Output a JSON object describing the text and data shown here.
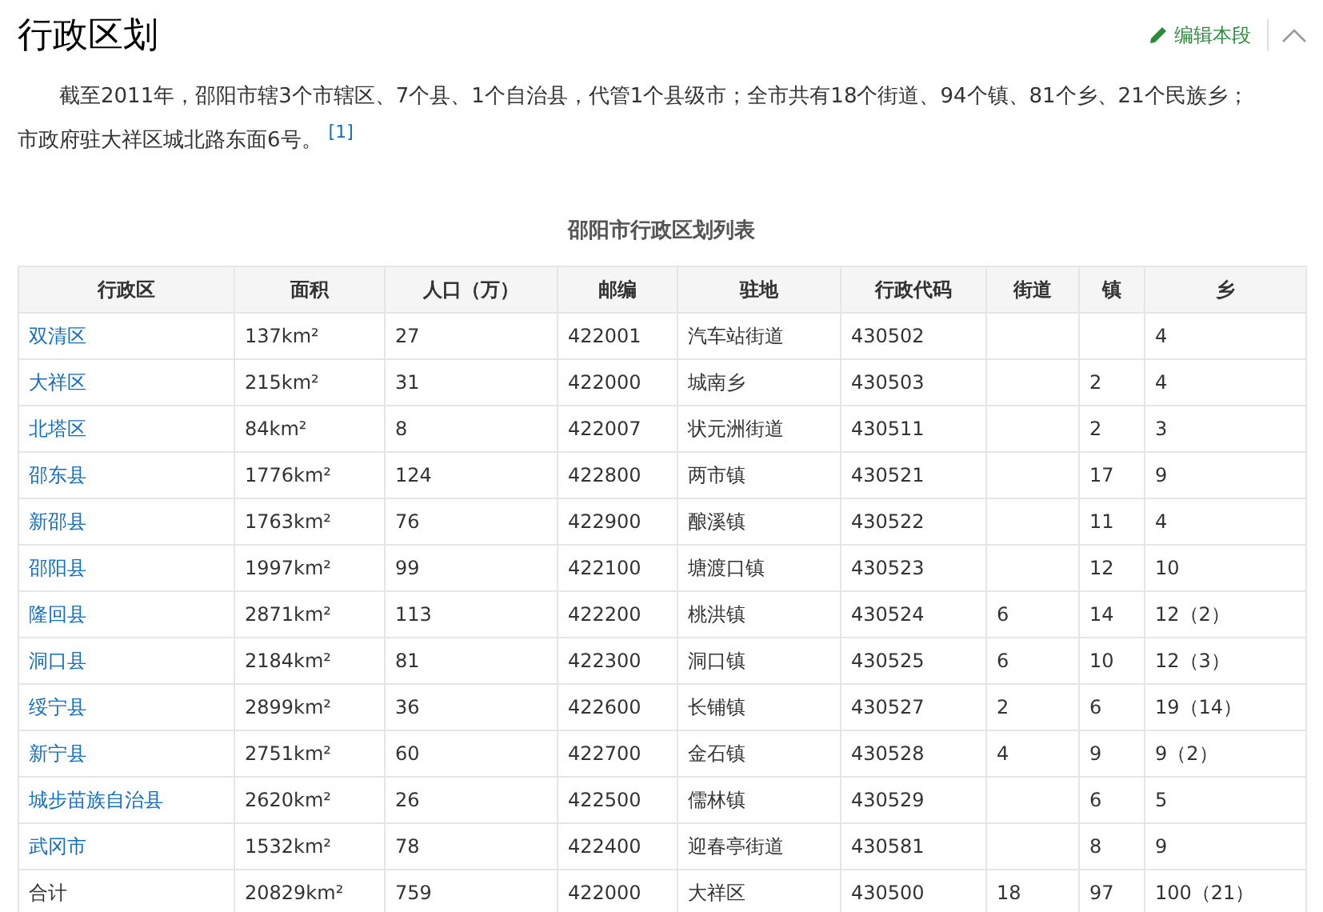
{
  "section": {
    "title": "行政区划",
    "edit_label": "编辑本段"
  },
  "paragraph": {
    "text": "截至2011年，邵阳市辖3个市辖区、7个县、1个自治县，代管1个县级市；全市共有18个街道、94个镇、81个乡、21个民族乡；市政府驻大祥区城北路东面6号。",
    "reference": "[1]"
  },
  "table": {
    "caption": "邵阳市行政区划列表",
    "columns": [
      "行政区",
      "面积",
      "人口（万）",
      "邮编",
      "驻地",
      "行政代码",
      "街道",
      "镇",
      "乡"
    ],
    "rows": [
      {
        "linked": true,
        "cells": [
          "双清区",
          "137km²",
          "27",
          "422001",
          "汽车站街道",
          "430502",
          "",
          "",
          "4"
        ]
      },
      {
        "linked": true,
        "cells": [
          "大祥区",
          "215km²",
          "31",
          "422000",
          "城南乡",
          "430503",
          "",
          "2",
          "4"
        ]
      },
      {
        "linked": true,
        "cells": [
          "北塔区",
          "84km²",
          "8",
          "422007",
          "状元洲街道",
          "430511",
          "",
          "2",
          "3"
        ]
      },
      {
        "linked": true,
        "cells": [
          "邵东县",
          "1776km²",
          "124",
          "422800",
          "两市镇",
          "430521",
          "",
          "17",
          "9"
        ]
      },
      {
        "linked": true,
        "cells": [
          "新邵县",
          "1763km²",
          "76",
          "422900",
          "酿溪镇",
          "430522",
          "",
          "11",
          "4"
        ]
      },
      {
        "linked": true,
        "cells": [
          "邵阳县",
          "1997km²",
          "99",
          "422100",
          "塘渡口镇",
          "430523",
          "",
          "12",
          "10"
        ]
      },
      {
        "linked": true,
        "cells": [
          "隆回县",
          "2871km²",
          "113",
          "422200",
          "桃洪镇",
          "430524",
          "6",
          "14",
          "12（2）"
        ]
      },
      {
        "linked": true,
        "cells": [
          "洞口县",
          "2184km²",
          "81",
          "422300",
          "洞口镇",
          "430525",
          "6",
          "10",
          "12（3）"
        ]
      },
      {
        "linked": true,
        "cells": [
          "绥宁县",
          "2899km²",
          "36",
          "422600",
          "长铺镇",
          "430527",
          "2",
          "6",
          "19（14）"
        ]
      },
      {
        "linked": true,
        "cells": [
          "新宁县",
          "2751km²",
          "60",
          "422700",
          "金石镇",
          "430528",
          "4",
          "9",
          "9（2）"
        ]
      },
      {
        "linked": true,
        "cells": [
          "城步苗族自治县",
          "2620km²",
          "26",
          "422500",
          "儒林镇",
          "430529",
          "",
          "6",
          "5"
        ]
      },
      {
        "linked": true,
        "cells": [
          "武冈市",
          "1532km²",
          "78",
          "422400",
          "迎春亭街道",
          "430581",
          "",
          "8",
          "9"
        ]
      },
      {
        "linked": false,
        "cells": [
          "合计",
          "20829km²",
          "759",
          "422000",
          "大祥区",
          "430500",
          "18",
          "97",
          "100（21）"
        ]
      }
    ]
  }
}
